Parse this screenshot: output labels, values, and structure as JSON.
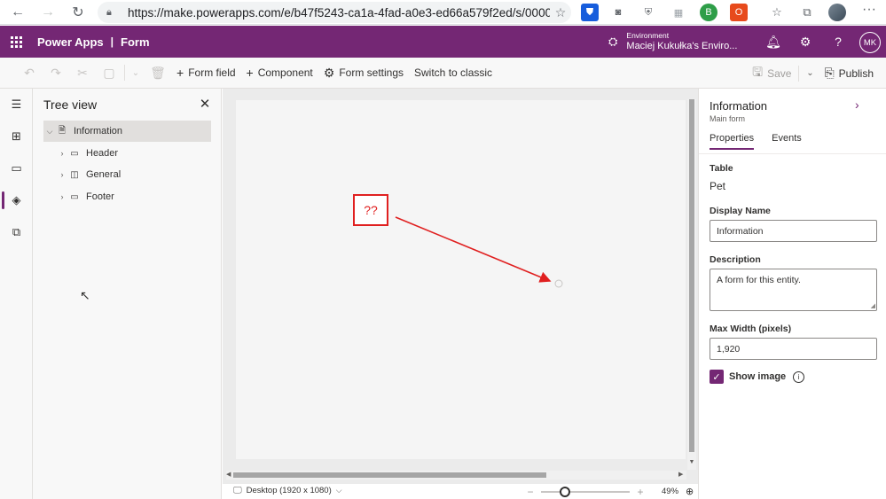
{
  "browser": {
    "url": "https://make.powerapps.com/e/b47f5243-ca1a-4fad-a0e3-ed66a579f2ed/s/0000000...",
    "more_label": "···"
  },
  "header": {
    "app_name": "Power Apps",
    "separator": "|",
    "section": "Form",
    "environment_label": "Environment",
    "environment_name": "Maciej Kukułka's Enviro...",
    "user_initials": "MK",
    "brand_color": "#742774"
  },
  "commandbar": {
    "form_field": "Form field",
    "component": "Component",
    "form_settings": "Form settings",
    "switch_classic": "Switch to classic",
    "save": "Save",
    "publish": "Publish"
  },
  "tree": {
    "title": "Tree view",
    "items": [
      {
        "label": "Information"
      },
      {
        "label": "Header"
      },
      {
        "label": "General"
      },
      {
        "label": "Footer"
      }
    ]
  },
  "canvas": {
    "annotation": "??"
  },
  "status": {
    "device": "Desktop (1920 x 1080)",
    "zoom": "49%"
  },
  "properties": {
    "title": "Information",
    "subtitle": "Main form",
    "tabs": [
      "Properties",
      "Events"
    ],
    "table_label": "Table",
    "table_value": "Pet",
    "display_name_label": "Display Name",
    "display_name_value": "Information",
    "description_label": "Description",
    "description_value": "A form for this entity.",
    "max_width_label": "Max Width (pixels)",
    "max_width_value": "1,920",
    "show_image_label": "Show image",
    "show_image_checked": true
  }
}
